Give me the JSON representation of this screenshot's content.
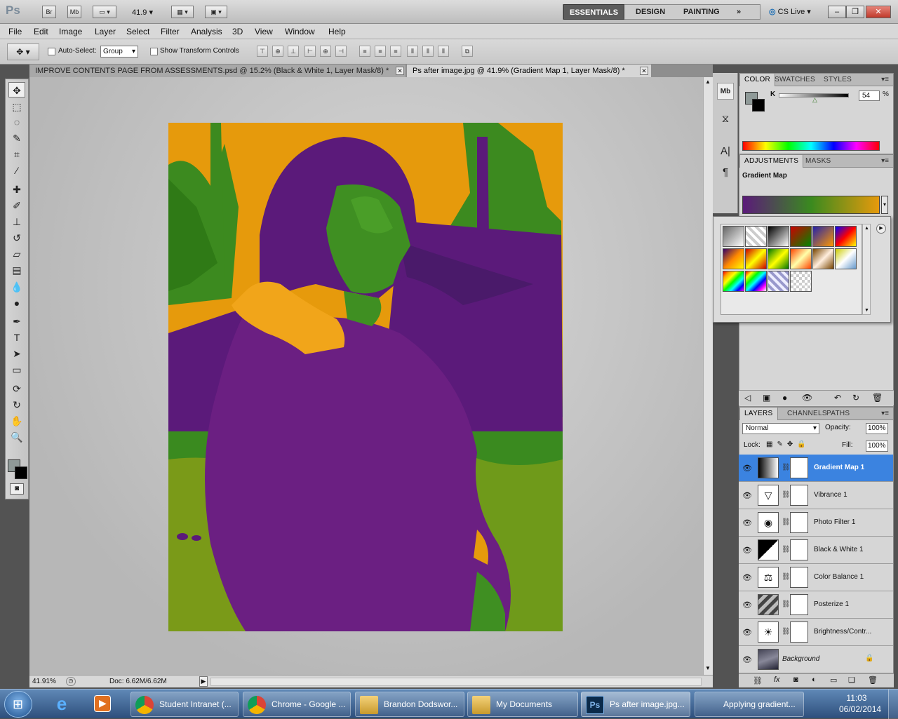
{
  "appbar": {
    "logo": "Ps",
    "bridge": "Br",
    "mini_bridge": "Mb",
    "zoom": "41.9",
    "workspaces": [
      "ESSENTIALS",
      "DESIGN",
      "PAINTING"
    ],
    "more": "»",
    "cslive": "CS Live"
  },
  "menu": [
    "File",
    "Edit",
    "Image",
    "Layer",
    "Select",
    "Filter",
    "Analysis",
    "3D",
    "View",
    "Window",
    "Help"
  ],
  "options": {
    "auto_select_label": "Auto-Select:",
    "auto_select_value": "Group",
    "show_transform_label": "Show Transform Controls"
  },
  "tabs": [
    {
      "label": "IMPROVE CONTENTS PAGE FROM ASSESSMENTS.psd @ 15.2% (Black & White 1, Layer Mask/8) *"
    },
    {
      "label": "Ps after image.jpg @ 41.9% (Gradient Map 1, Layer Mask/8) *"
    }
  ],
  "status": {
    "zoom": "41.91%",
    "doc": "Doc: 6.62M/6.62M"
  },
  "color_panel": {
    "tabs": [
      "COLOR",
      "SWATCHES",
      "STYLES"
    ],
    "channel": "K",
    "value": "54",
    "fg_color": "#8f9a98",
    "bg_color": "#000000"
  },
  "adjustments": {
    "tabs": [
      "ADJUSTMENTS",
      "MASKS"
    ],
    "title": "Gradient Map",
    "gradient_colors": [
      "#5b1a7a",
      "#3a8a1f",
      "#e69a0c"
    ]
  },
  "layers_panel": {
    "tabs": [
      "LAYERS",
      "CHANNELS",
      "PATHS"
    ],
    "blend_mode": "Normal",
    "opacity_label": "Opacity:",
    "opacity": "100%",
    "lock_label": "Lock:",
    "fill_label": "Fill:",
    "fill": "100%",
    "layers": [
      {
        "name": "Gradient Map 1",
        "icon": "gradient-map-icon",
        "selected": true
      },
      {
        "name": "Vibrance 1",
        "icon": "vibrance-icon",
        "selected": false
      },
      {
        "name": "Photo Filter 1",
        "icon": "photo-filter-icon",
        "selected": false
      },
      {
        "name": "Black & White 1",
        "icon": "black-white-icon",
        "selected": false
      },
      {
        "name": "Color Balance 1",
        "icon": "color-balance-icon",
        "selected": false
      },
      {
        "name": "Posterize 1",
        "icon": "posterize-icon",
        "selected": false
      },
      {
        "name": "Brightness/Contr...",
        "icon": "brightness-contrast-icon",
        "selected": false
      },
      {
        "name": "Background",
        "icon": "background-thumbnail",
        "selected": false
      }
    ]
  },
  "taskbar": {
    "items": [
      {
        "label": "Student Intranet (..."
      },
      {
        "label": "Chrome - Google ..."
      },
      {
        "label": "Brandon Dodswor..."
      },
      {
        "label": "My Documents"
      },
      {
        "label": "Ps after image.jpg..."
      },
      {
        "label": "Applying gradient..."
      }
    ],
    "time": "11:03",
    "date": "06/02/2014"
  }
}
